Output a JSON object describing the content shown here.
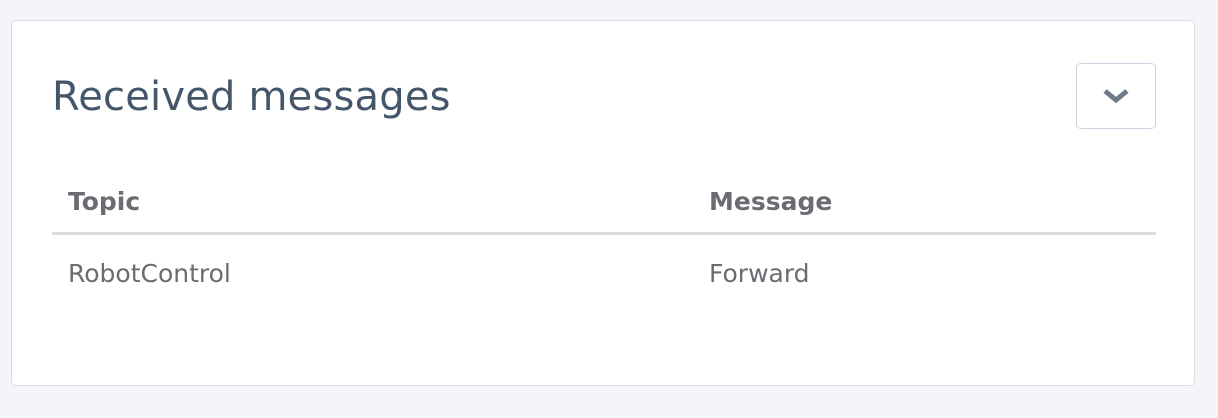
{
  "panel": {
    "title": "Received messages",
    "toggle_icon": "chevron-down-icon"
  },
  "table": {
    "headers": [
      "Topic",
      "Message"
    ],
    "rows": [
      [
        "RobotControl",
        "Forward"
      ]
    ]
  },
  "colors": {
    "background": "#f4f5f9",
    "card": "#ffffff",
    "title": "#44566a",
    "table_text": "#6a6c72",
    "chevron": "#707a89"
  }
}
